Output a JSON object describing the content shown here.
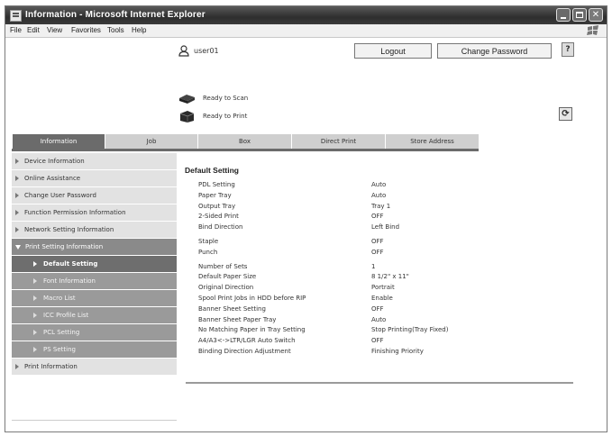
{
  "window": {
    "title": "Information - Microsoft Internet Explorer"
  },
  "menu": [
    "File",
    "Edit",
    "View",
    "Favorites",
    "Tools",
    "Help"
  ],
  "header": {
    "user_name": "user01",
    "logout_label": "Logout",
    "change_password_label": "Change Password",
    "help_label": "?"
  },
  "status": {
    "scan_text": "Ready to Scan",
    "print_text": "Ready to Print"
  },
  "tabs": [
    {
      "label": "Information",
      "active": true
    },
    {
      "label": "Job",
      "active": false
    },
    {
      "label": "Box",
      "active": false
    },
    {
      "label": "Direct Print",
      "active": false
    },
    {
      "label": "Store Address",
      "active": false
    }
  ],
  "sidebar": {
    "items": [
      {
        "label": "Device Information"
      },
      {
        "label": "Online Assistance"
      },
      {
        "label": "Change User Password"
      },
      {
        "label": "Function Permission Information"
      },
      {
        "label": "Network Setting Information"
      },
      {
        "label": "Print Setting Information"
      }
    ],
    "subitems": [
      {
        "label": "Default Setting"
      },
      {
        "label": "Font Information"
      },
      {
        "label": "Macro List"
      },
      {
        "label": "ICC Profile List"
      },
      {
        "label": "PCL Setting"
      },
      {
        "label": "PS Setting"
      }
    ],
    "last_item": {
      "label": "Print Information"
    }
  },
  "main": {
    "title": "Default Setting",
    "rows": [
      {
        "label": "PDL Setting",
        "value": "Auto"
      },
      {
        "label": "Paper Tray",
        "value": "Auto"
      },
      {
        "label": "Output Tray",
        "value": "Tray 1"
      },
      {
        "label": "2-Sided Print",
        "value": "OFF"
      },
      {
        "label": "Bind Direction",
        "value": "Left Bind"
      },
      {
        "label": "Staple",
        "value": "OFF"
      },
      {
        "label": "Punch",
        "value": "OFF"
      },
      {
        "label": "Number of Sets",
        "value": "1"
      },
      {
        "label": "Default Paper Size",
        "value": "8 1/2\" x 11\""
      },
      {
        "label": "Original Direction",
        "value": "Portrait"
      },
      {
        "label": "Spool Print Jobs in HDD before RIP",
        "value": "Enable"
      },
      {
        "label": "Banner Sheet Setting",
        "value": "OFF"
      },
      {
        "label": "Banner Sheet Paper Tray",
        "value": "Auto"
      },
      {
        "label": "No Matching Paper in Tray Setting",
        "value": "Stop Printing(Tray Fixed)"
      },
      {
        "label": "A4/A3<->LTR/LGR Auto Switch",
        "value": "OFF"
      },
      {
        "label": "Binding Direction Adjustment",
        "value": "Finishing Priority"
      }
    ]
  }
}
